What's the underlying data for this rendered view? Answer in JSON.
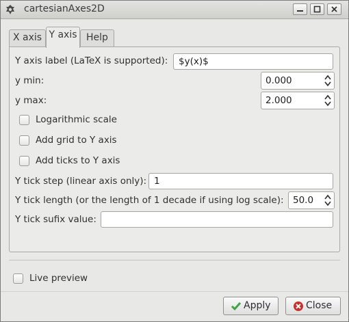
{
  "window": {
    "title": "cartesianAxes2D"
  },
  "tabs": [
    {
      "label": "X axis",
      "active": false
    },
    {
      "label": "Y axis",
      "active": true
    },
    {
      "label": "Help",
      "active": false
    }
  ],
  "yaxis": {
    "label_caption": "Y axis label (LaTeX is supported):",
    "label_value": "$y(x)$",
    "ymin_caption": "y min:",
    "ymin_value": "0.000",
    "ymax_caption": "y max:",
    "ymax_value": "2.000",
    "log_scale_label": "Logarithmic scale",
    "log_scale_checked": false,
    "grid_label": "Add grid to Y axis",
    "grid_checked": false,
    "ticks_label": "Add ticks to Y axis",
    "ticks_checked": false,
    "tick_step_caption": "Y tick step (linear axis only):",
    "tick_step_value": "1",
    "tick_length_caption": "Y tick length (or the length of 1 decade if using log scale):",
    "tick_length_value": "50.0",
    "tick_suffix_caption": "Y tick sufix value:",
    "tick_suffix_value": ""
  },
  "footer": {
    "live_preview_label": "Live preview",
    "live_preview_checked": false,
    "apply_label": "Apply",
    "close_label": "Close"
  },
  "colors": {
    "apply_check": "#3fa33f",
    "close_icon": "#c9302c"
  }
}
